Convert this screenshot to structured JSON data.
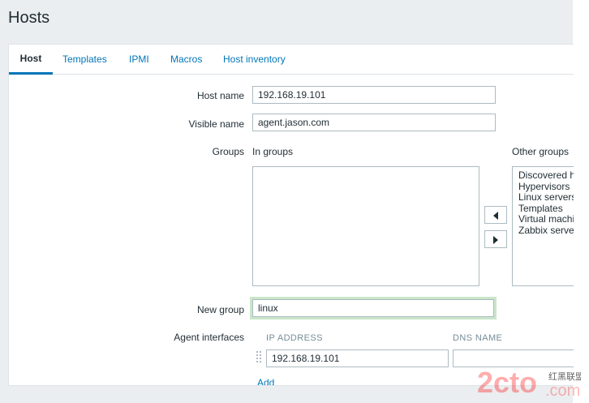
{
  "header": {
    "title": "Hosts"
  },
  "tabs": [
    {
      "label": "Host",
      "active": true
    },
    {
      "label": "Templates"
    },
    {
      "label": "IPMI"
    },
    {
      "label": "Macros"
    },
    {
      "label": "Host inventory"
    }
  ],
  "form": {
    "host_name": {
      "label": "Host name",
      "value": "192.168.19.101"
    },
    "visible_name": {
      "label": "Visible name",
      "value": "agent.jason.com"
    },
    "groups": {
      "label": "Groups",
      "in_groups_label": "In groups",
      "other_groups_label": "Other groups",
      "in_groups": [],
      "other_groups": [
        "Discovered hosts",
        "Hypervisors",
        "Linux servers",
        "Templates",
        "Virtual machines",
        "Zabbix servers"
      ]
    },
    "new_group": {
      "label": "New group",
      "value": "linux"
    },
    "agent_interfaces": {
      "label": "Agent interfaces",
      "col_ip": "IP ADDRESS",
      "col_dns": "DNS NAME",
      "ip_value": "192.168.19.101",
      "dns_value": "",
      "add_label": "Add"
    }
  },
  "watermark": {
    "text": "2cto",
    "suffix": ".com",
    "cn": "红黑联盟"
  },
  "colors": {
    "link": "#0275b8",
    "border": "#acbbc2",
    "header_bg": "#ebeef0",
    "focus_ring": "#c9e6c9"
  }
}
